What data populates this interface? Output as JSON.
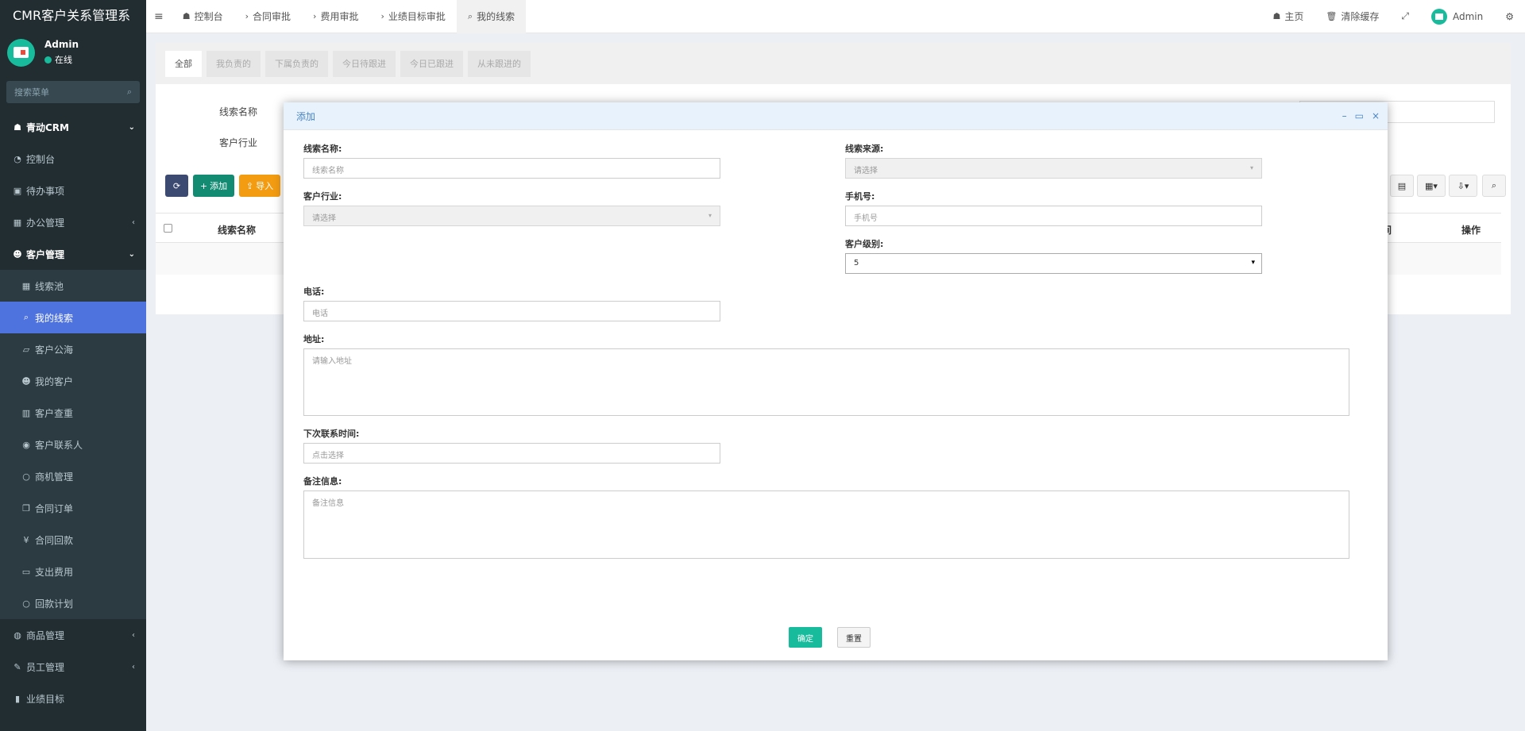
{
  "app": {
    "title": "CMR客户关系管理系",
    "user_name": "Admin",
    "user_status": "在线",
    "search_placeholder": "搜索菜单"
  },
  "sidebar": {
    "items": [
      {
        "label": "青动CRM",
        "icon": "home-icon",
        "header": true,
        "arrow": "⌄"
      },
      {
        "label": "控制台",
        "icon": "dashboard-icon"
      },
      {
        "label": "待办事项",
        "icon": "calendar-icon"
      },
      {
        "label": "办公管理",
        "icon": "windows-icon",
        "arrow": "‹"
      },
      {
        "label": "客户管理",
        "icon": "users-icon",
        "header": true,
        "arrow": "⌄"
      },
      {
        "label": "线索池",
        "icon": "grid-icon",
        "sub": true
      },
      {
        "label": "我的线索",
        "icon": "search-plus-icon",
        "sub": true,
        "active": true
      },
      {
        "label": "客户公海",
        "icon": "map-icon",
        "sub": true
      },
      {
        "label": "我的客户",
        "icon": "users-icon",
        "sub": true
      },
      {
        "label": "客户查重",
        "icon": "building-icon",
        "sub": true
      },
      {
        "label": "客户联系人",
        "icon": "user-circle-icon",
        "sub": true
      },
      {
        "label": "商机管理",
        "icon": "circle-icon",
        "sub": true
      },
      {
        "label": "合同订单",
        "icon": "copy-icon",
        "sub": true
      },
      {
        "label": "合同回款",
        "icon": "yen-icon",
        "sub": true
      },
      {
        "label": "支出费用",
        "icon": "money-icon",
        "sub": true
      },
      {
        "label": "回款计划",
        "icon": "circle-icon",
        "sub": true
      },
      {
        "label": "商品管理",
        "icon": "shopping-icon",
        "arrow": "‹"
      },
      {
        "label": "员工管理",
        "icon": "pencil-icon",
        "arrow": "‹"
      },
      {
        "label": "业绩目标",
        "icon": "bar-chart-icon"
      }
    ]
  },
  "topnav": {
    "menu_icon": "≡",
    "tabs": [
      {
        "label": "控制台",
        "prefix": "☗"
      },
      {
        "label": "合同审批",
        "prefix": "›"
      },
      {
        "label": "费用审批",
        "prefix": "›"
      },
      {
        "label": "业绩目标审批",
        "prefix": "›"
      },
      {
        "label": "我的线索",
        "prefix": "⌕",
        "active": true
      }
    ],
    "home": "主页",
    "clear_cache": "清除缓存",
    "user": "Admin"
  },
  "content": {
    "tabs": [
      "全部",
      "我负责的",
      "下属负责的",
      "今日待跟进",
      "今日已跟进",
      "从未跟进的"
    ],
    "filter_labels": {
      "clue_name": "线索名称",
      "industry": "客户行业"
    },
    "toolbar": {
      "add": "添加",
      "import": "导入"
    },
    "table_headers": {
      "clue_name": "线索名称",
      "time_fragment": "间",
      "action": "操作"
    }
  },
  "modal": {
    "title": "添加",
    "fields": {
      "clue_name": {
        "label": "线索名称:",
        "placeholder": "线索名称"
      },
      "source": {
        "label": "线索来源:",
        "placeholder": "请选择"
      },
      "industry": {
        "label": "客户行业:",
        "placeholder": "请选择"
      },
      "mobile": {
        "label": "手机号:",
        "placeholder": "手机号"
      },
      "level": {
        "label": "客户级别:",
        "value": "5"
      },
      "phone": {
        "label": "电话:",
        "placeholder": "电话"
      },
      "address": {
        "label": "地址:",
        "placeholder": "请输入地址"
      },
      "next_contact": {
        "label": "下次联系时间:",
        "placeholder": "点击选择"
      },
      "remarks": {
        "label": "备注信息:",
        "placeholder": "备注信息"
      }
    },
    "ok": "确定",
    "reset": "重置"
  }
}
